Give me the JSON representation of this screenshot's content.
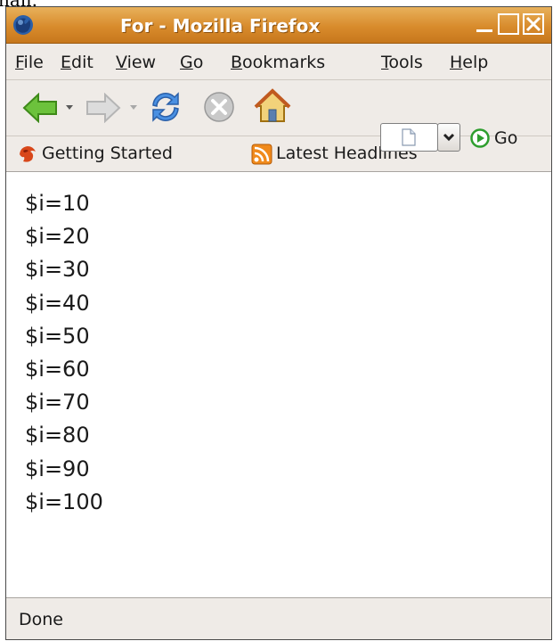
{
  "window": {
    "title": "For - Mozilla Firefox"
  },
  "menu": {
    "items": [
      {
        "label": "File"
      },
      {
        "label": "Edit"
      },
      {
        "label": "View"
      },
      {
        "label": "Go"
      },
      {
        "label": "Bookmarks"
      },
      {
        "label": "Tools"
      },
      {
        "label": "Help"
      }
    ]
  },
  "navigation": {
    "back_icon": "back-arrow-icon",
    "forward_icon": "forward-arrow-icon",
    "reload_icon": "reload-icon",
    "stop_icon": "stop-icon",
    "home_icon": "home-icon",
    "go_label": "Go",
    "address_value": ""
  },
  "bookmarks": {
    "items": [
      {
        "label": "Getting Started",
        "icon": "firefox-bookmark-icon"
      },
      {
        "label": "Latest Headlines",
        "icon": "rss-feed-icon"
      }
    ]
  },
  "content": {
    "lines": [
      "$i=10",
      "$i=20",
      "$i=30",
      "$i=40",
      "$i=50",
      "$i=60",
      "$i=70",
      "$i=80",
      "$i=90",
      "$i=100"
    ]
  },
  "status": {
    "text": "Done"
  },
  "top_fragment": {
    "text": "nail."
  },
  "colors": {
    "titlebar": "#d88b2c",
    "chrome": "#efebe7",
    "back_arrow": "#5aa82a",
    "reload": "#3a7fd5",
    "go_green": "#3bb13b"
  }
}
